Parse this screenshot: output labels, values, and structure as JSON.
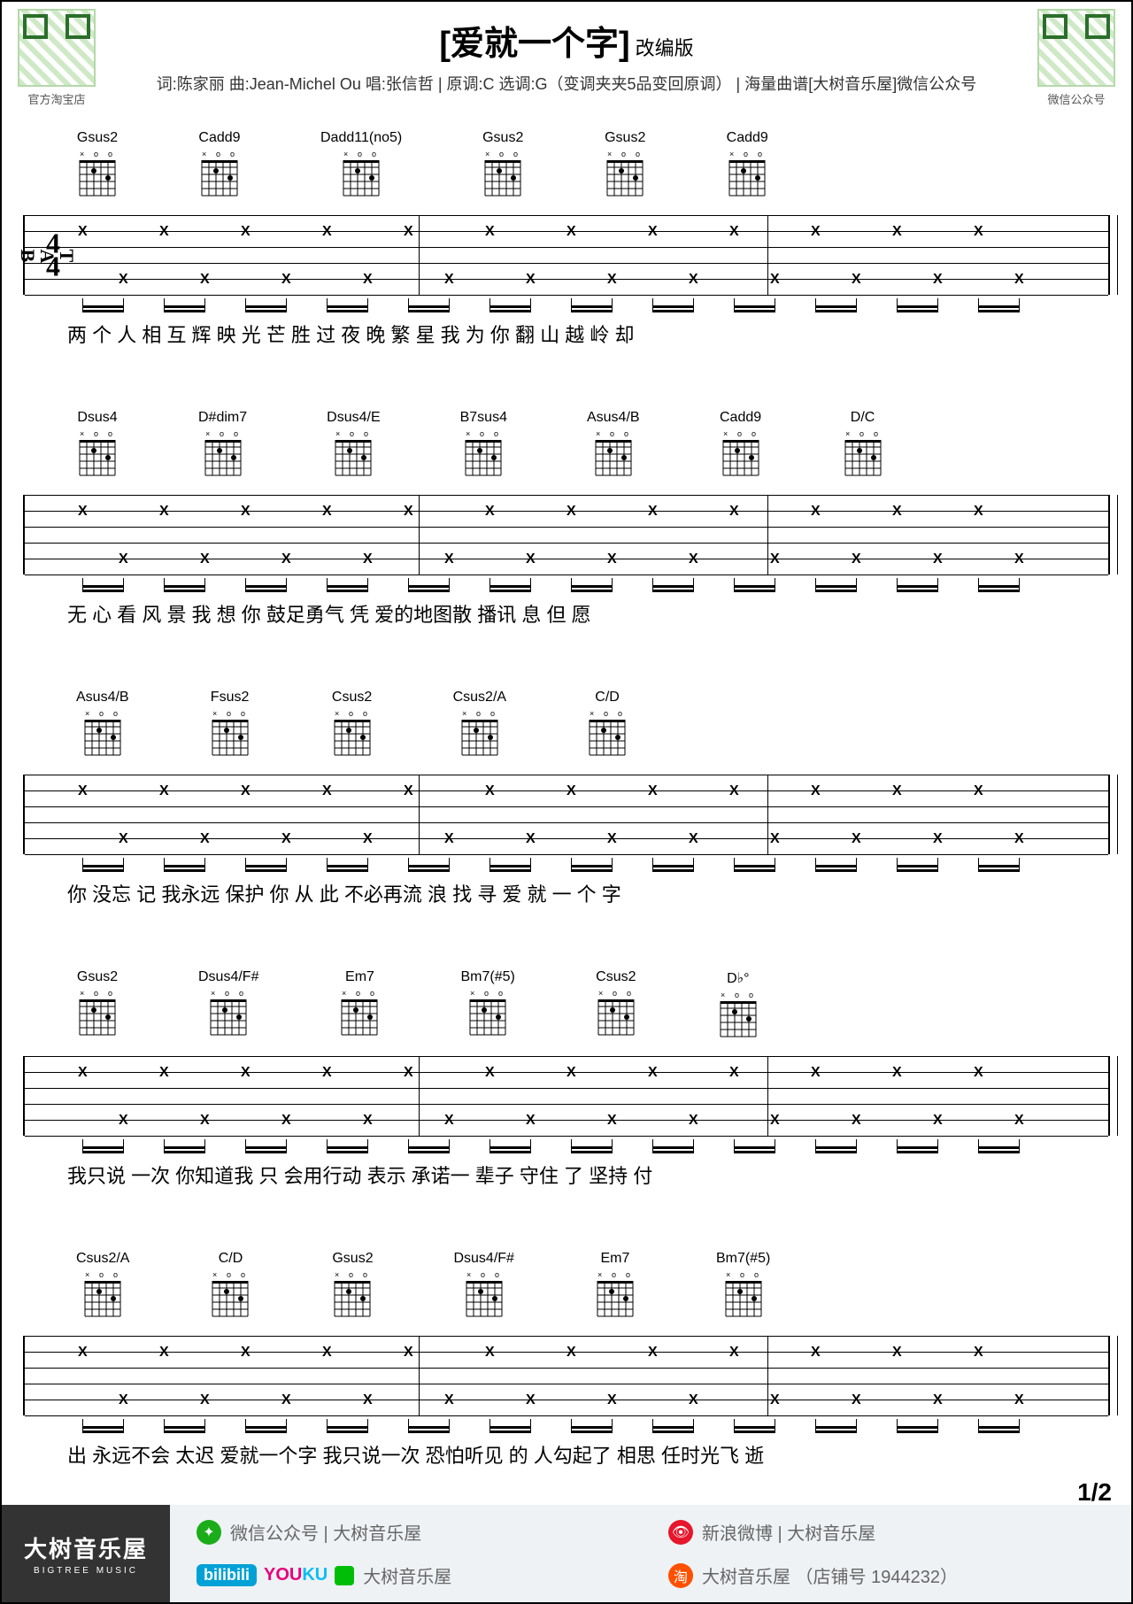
{
  "header": {
    "qr_left_caption": "官方淘宝店",
    "qr_right_caption": "微信公众号",
    "title_main": "[爱就一个字]",
    "title_sub": "改编版",
    "meta_line": "词:陈家丽  曲:Jean-Michel Ou  唱:张信哲 | 原调:C  选调:G（变调夹夹5品变回原调） | 海量曲谱[大树音乐屋]微信公众号"
  },
  "time_signature": {
    "top": "4",
    "bottom": "4"
  },
  "tab_label": "TAB",
  "systems": [
    {
      "chords": [
        "Gsus2",
        "Cadd9",
        "Dadd11(no5)",
        "Gsus2",
        "Gsus2",
        "Cadd9"
      ],
      "lyrics": "两  个 人 相 互 辉   映        光 芒   胜 过  夜 晚    繁 星        我   为 你 翻 山 越 岭        却"
    },
    {
      "chords": [
        "Dsus4",
        "D#dim7",
        "Dsus4/E",
        "B7sus4",
        "Asus4/B",
        "Cadd9",
        "D/C"
      ],
      "lyrics": "无   心   看  风 景       我   想   你      鼓足勇气            凭  爱的地图散   播讯 息       但  愿"
    },
    {
      "chords": [
        "Asus4/B",
        "Fsus2",
        "Csus2",
        "Csus2/A",
        "C/D"
      ],
      "lyrics": "你    没忘  记        我永远  保护   你      从 此 不必再流   浪  找       寻     爱 就 一 个 字"
    },
    {
      "chords": [
        "Gsus2",
        "Dsus4/F#",
        "Em7",
        "Bm7(#5)",
        "Csus2",
        "D♭°"
      ],
      "lyrics": "我只说 一次        你知道我  只   会用行动  表示      承诺一 辈子      守住 了 坚持              付"
    },
    {
      "chords": [
        "Csus2/A",
        "C/D",
        "Gsus2",
        "Dsus4/F#",
        "Em7",
        "Bm7(#5)"
      ],
      "lyrics": "出 永远不会  太迟       爱就一个字    我只说一次     恐怕听见 的  人勾起了  相思      任时光飞 逝"
    }
  ],
  "footer": {
    "brand_cn": "大树音乐屋",
    "brand_en": "BIGTREE  MUSIC",
    "wechat": "微信公众号 | 大树音乐屋",
    "weibo": "新浪微博 | 大树音乐屋",
    "video_suffix": "大树音乐屋",
    "taobao": "大树音乐屋 （店铺号 1944232）",
    "page": "1/2",
    "bili": "bilibili",
    "youku": "YOUKU"
  }
}
